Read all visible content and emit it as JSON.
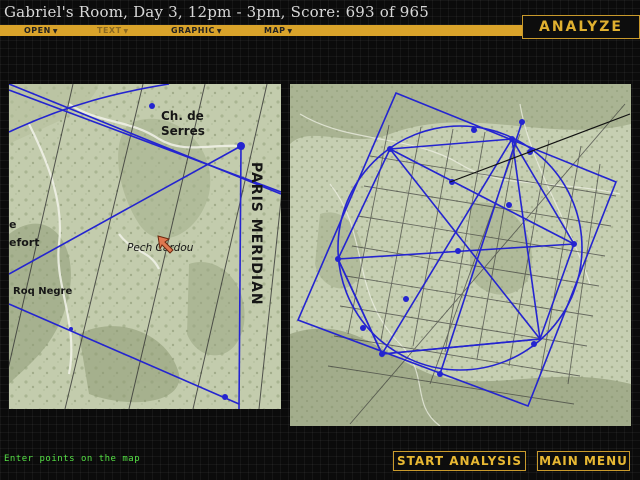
{
  "title": "Gabriel's Room, Day 3, 12pm - 3pm, Score: 693 of 965",
  "menu": [
    {
      "label": "OPEN",
      "enabled": true
    },
    {
      "label": "TEXT",
      "enabled": false
    },
    {
      "label": "GRAPHIC",
      "enabled": true
    },
    {
      "label": "MAP",
      "enabled": true
    }
  ],
  "mode_label": "ANALYZE",
  "left_map": {
    "labels": {
      "ch_de": "Ch. de",
      "serres": "Serres",
      "paris_meridian": "PARIS MERIDIAN",
      "pech_cardou": "Pech Cardou",
      "e": "e",
      "efort": "efort",
      "roq_negre": "Roq Negre"
    }
  },
  "status": "Enter points on the map",
  "buttons": {
    "start_analysis": "START ANALYSIS",
    "main_menu": "MAIN MENU"
  },
  "colors": {
    "accent": "#d9a32a",
    "button_text": "#e8b833",
    "status_text": "#55e045",
    "overlay_line": "#2424d0",
    "map_paper": "#c4cdb0"
  }
}
